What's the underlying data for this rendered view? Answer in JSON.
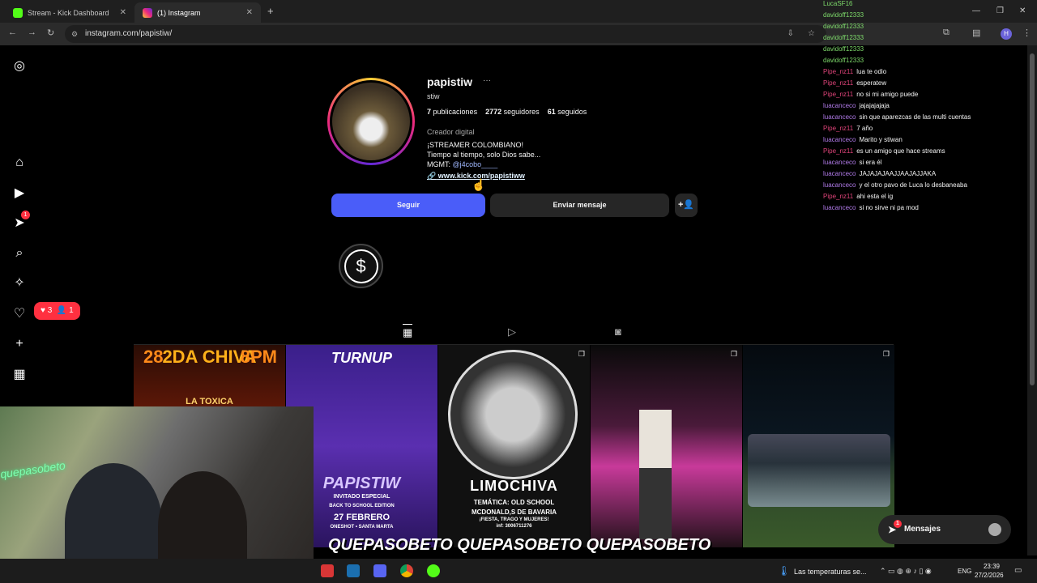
{
  "browser": {
    "tabs": [
      {
        "label": "Stream - Kick Dashboard"
      },
      {
        "label": "(1) Instagram"
      }
    ],
    "url": "instagram.com/papistiw/",
    "profile_initial": "H"
  },
  "profile": {
    "username": "papistiw",
    "more": "···",
    "full_name": "stiw",
    "posts_count": "7",
    "posts_label": "publicaciones",
    "followers_count": "2772",
    "followers_label": "seguidores",
    "following_count": "61",
    "following_label": "seguidos",
    "category": "Creador digital",
    "bio_line1": "¡STREAMER COLOMBIANO!",
    "bio_line2": "Tiempo al tiempo, solo Dios sabe...",
    "bio_mgmt_prefix": "MGMT:",
    "bio_mgmt_handle": "@j4cobo____",
    "link": "www.kick.com/papistiww"
  },
  "actions": {
    "follow": "Seguir",
    "message": "Enviar mensaje"
  },
  "highlight": {
    "label": ""
  },
  "notifications": {
    "likes": "3",
    "follows": "1",
    "nav_badge": "1"
  },
  "posts": [
    {
      "line1": "28",
      "line2": "2DA CHIVA",
      "line3": "8PM",
      "line4": "LA TOXICA"
    },
    {
      "line1": "TURNUP",
      "line2": "PAPISTIW",
      "line3": "INVITADO ESPECIAL",
      "line4": "BACK TO SCHOOL EDITION",
      "line5": "27 FEBRERO",
      "line6": "ONESHOT • SANTA MARTA"
    },
    {
      "line1": "LIMOCHIVA",
      "line2": "TEMÁTICA: OLD SCHOOL",
      "line3": "MCDONALD,S DE BAVARIA",
      "line4": "¡FIESTA, TRAGO Y MUJERES!",
      "line5": "inf: 3006711276"
    },
    {
      "line1": ""
    },
    {
      "line1": ""
    }
  ],
  "chat": [
    {
      "user": "LucaSF16",
      "text": "",
      "color": "#7dd86a"
    },
    {
      "user": "davidoff12333",
      "text": "",
      "color": "#7dd86a"
    },
    {
      "user": "davidoff12333",
      "text": "",
      "color": "#7dd86a"
    },
    {
      "user": "davidoff12333",
      "text": "",
      "color": "#7dd86a"
    },
    {
      "user": "davidoff12333",
      "text": "",
      "color": "#7dd86a"
    },
    {
      "user": "davidoff12333",
      "text": "",
      "color": "#7dd86a"
    },
    {
      "user": "Pipe_nz11",
      "text": "lua te odio",
      "color": "#e0447a"
    },
    {
      "user": "Pipe_nz11",
      "text": "esperatew",
      "color": "#e0447a"
    },
    {
      "user": "Pipe_nz11",
      "text": "no si mi amigo puede",
      "color": "#e0447a"
    },
    {
      "user": "luacanceco",
      "text": "jajajajajaja",
      "color": "#b07ae8"
    },
    {
      "user": "luacanceco",
      "text": "sin que aparezcas de las multi cuentas",
      "color": "#b07ae8"
    },
    {
      "user": "Pipe_nz11",
      "text": "7 año",
      "color": "#e0447a"
    },
    {
      "user": "luacanceco",
      "text": "Marito y stiwan",
      "color": "#b07ae8"
    },
    {
      "user": "Pipe_nz11",
      "text": "es un amigo que hace streams",
      "color": "#e0447a"
    },
    {
      "user": "luacanceco",
      "text": "si era él",
      "color": "#b07ae8"
    },
    {
      "user": "luacanceco",
      "text": "JAJAJAJAAJJAAJAJJAKA",
      "color": "#b07ae8"
    },
    {
      "user": "luacanceco",
      "text": "y el otro pavo de Luca lo desbaneaba",
      "color": "#b07ae8"
    },
    {
      "user": "Pipe_nz11",
      "text": "ahi esta el ig",
      "color": "#e0447a"
    },
    {
      "user": "luacanceco",
      "text": "si no sirve ni pa mod",
      "color": "#b07ae8"
    }
  ],
  "overlay": {
    "text": "QUEPASOBETO QUEPASOBETO QUEPASOBETO"
  },
  "webcam": {
    "neon": "quepasobeto"
  },
  "messages": {
    "label": "Mensajes",
    "badge": "1"
  },
  "taskbar": {
    "weather": "Las temperaturas se...",
    "lang": "ENG",
    "time": "23:39",
    "date": "27/2/2026"
  },
  "colors": {
    "accent": "#4a5df9",
    "link": "#e0f1ff",
    "kick": "#53fc18"
  }
}
